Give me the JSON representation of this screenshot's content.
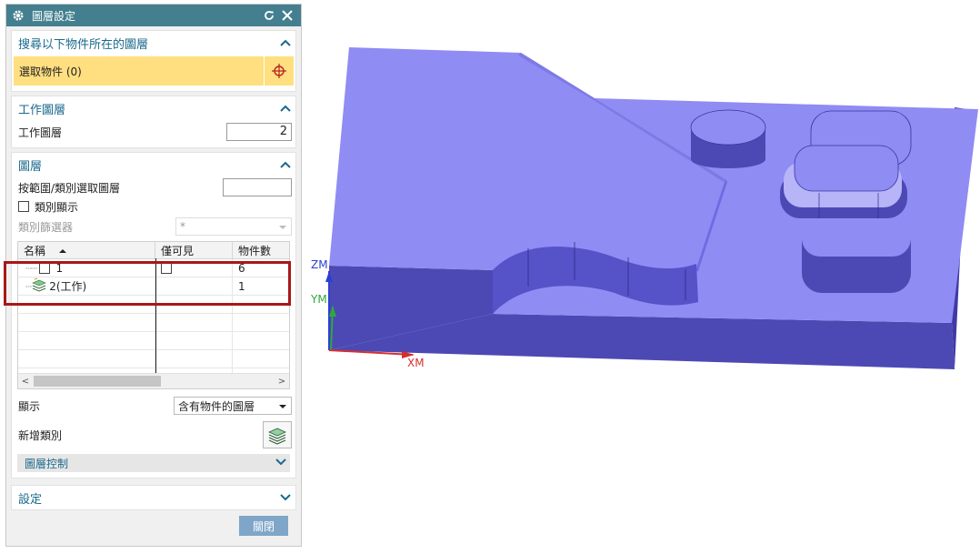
{
  "dialog": {
    "title": "圖層設定",
    "icons": {
      "title": "gear-icon",
      "reset": "reset-icon",
      "close": "close-icon"
    }
  },
  "search": {
    "title": "搜尋以下物件所在的圖層",
    "select_label": "選取物件 (0)"
  },
  "work_layer": {
    "title": "工作圖層",
    "label": "工作圖層",
    "value": "2"
  },
  "layers": {
    "title": "圖層",
    "range_label": "按範圍/類別選取圖層",
    "range_value": "",
    "show_category_label": "類別顯示",
    "filter_label": "類別篩選器",
    "filter_value": "*",
    "columns": [
      "名稱",
      "僅可見",
      "物件數"
    ],
    "rows": [
      {
        "name": "1",
        "count": "6"
      },
      {
        "name": "2(工作)",
        "count": "1"
      }
    ],
    "display_label": "顯示",
    "display_value": "含有物件的圖層",
    "new_category_label": "新增類別",
    "layer_control_label": "圖層控制"
  },
  "settings": {
    "title": "設定"
  },
  "close_label": "關閉",
  "viewport": {
    "axis_z": "ZM",
    "axis_y": "YM",
    "axis_x": "XM",
    "colors": {
      "top": "#8f8cf4",
      "side": "#4c49b4",
      "pocket": "#6f6ce0"
    }
  }
}
